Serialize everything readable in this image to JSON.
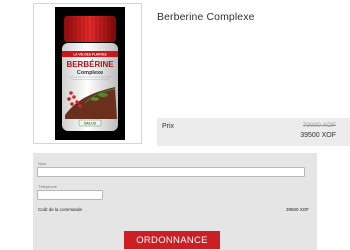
{
  "product": {
    "title": "Berberine Complexe",
    "image": {
      "brand_band": "LA VIE DES PLANTES",
      "name_line1": "BERBÉRINE",
      "name_line2": "Complexe",
      "logo": "SALUS"
    }
  },
  "price": {
    "label": "Prix",
    "old": "79000 XOF",
    "current": "39500 XOF"
  },
  "order_form": {
    "name_label": "Nom",
    "name_value": "",
    "phone_label": "Téléphone",
    "phone_value": "",
    "cost_label": "Coût de la commande",
    "cost_value": "39500 XOF",
    "submit_label": "ORDONNANCE"
  },
  "colors": {
    "accent": "#cc1f24",
    "panel": "#e5e5e5",
    "price_bg": "#ececec"
  }
}
